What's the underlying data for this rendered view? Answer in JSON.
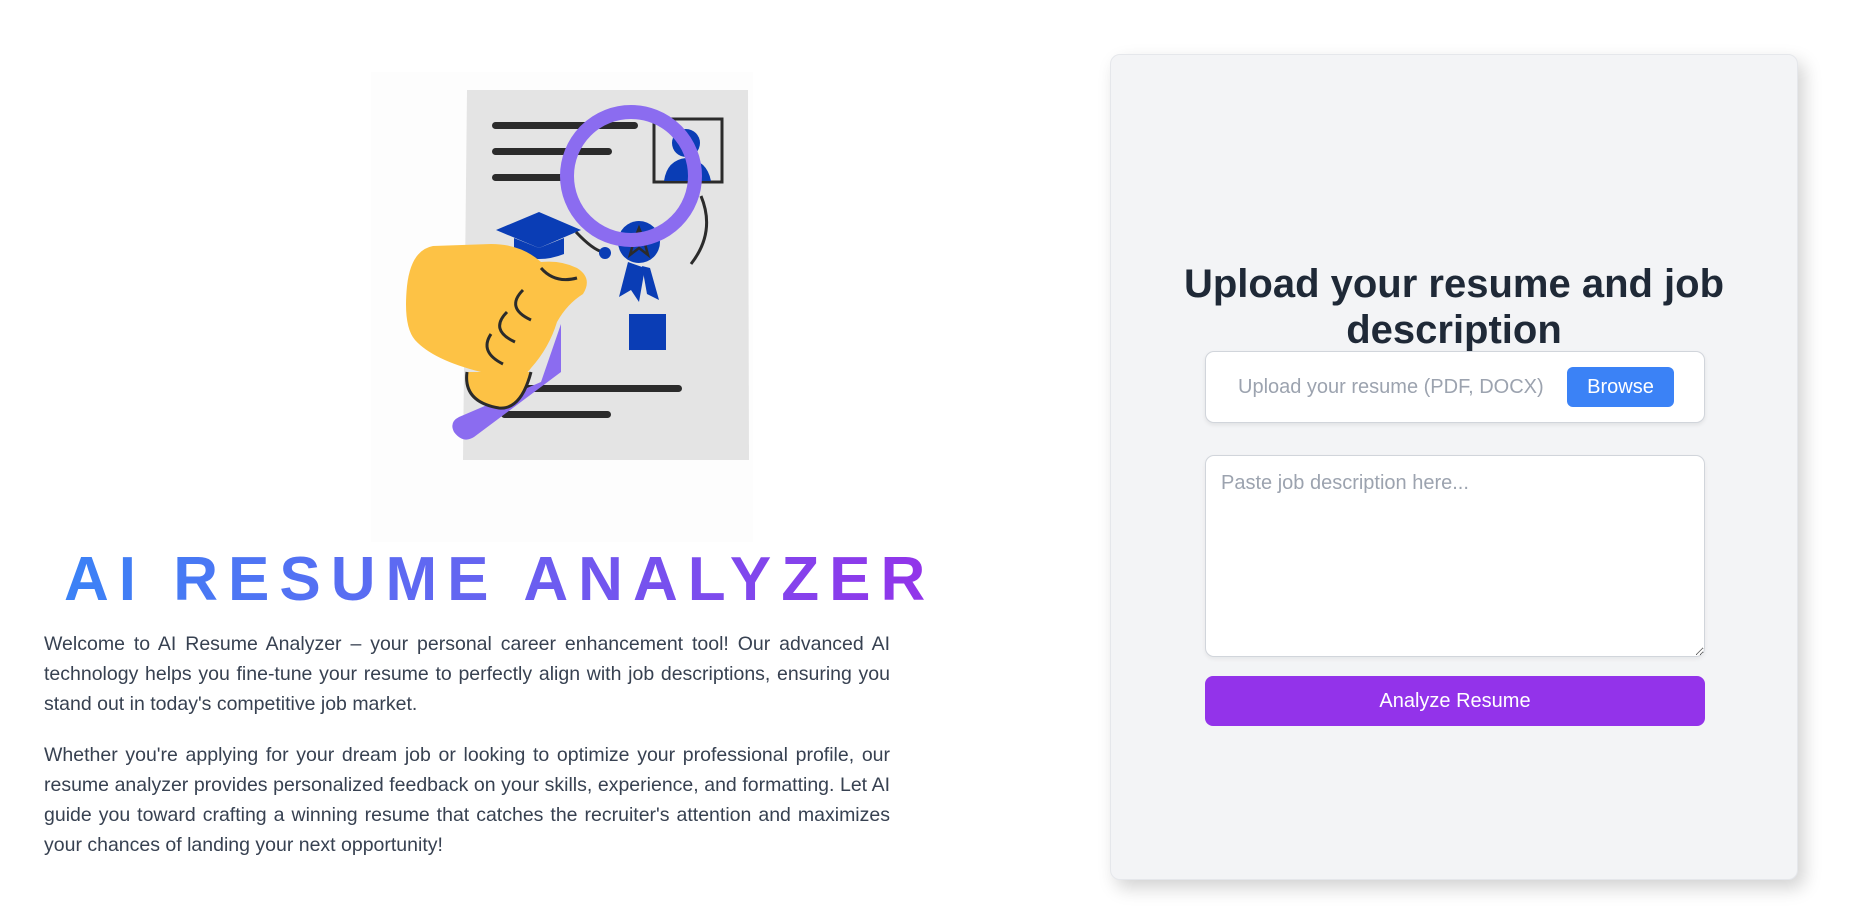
{
  "left": {
    "illustration_icon": "resume-magnifier-illustration",
    "title": "AI RESUME ANALYZER",
    "paragraphs": [
      "Welcome to AI Resume Analyzer – your personal career enhancement tool! Our advanced AI technology helps you fine-tune your resume to perfectly align with job descriptions, ensuring you stand out in today's competitive job market.",
      "Whether you're applying for your dream job or looking to optimize your professional profile, our resume analyzer provides personalized feedback on your skills, experience, and formatting. Let AI guide you toward crafting a winning resume that catches the recruiter's attention and maximizes your chances of landing your next opportunity!"
    ]
  },
  "form": {
    "title": "Upload your resume and job description",
    "upload_placeholder": "Upload your resume (PDF, DOCX)",
    "browse_label": "Browse",
    "job_description_placeholder": "Paste job description here...",
    "job_description_value": "",
    "analyze_label": "Analyze Resume"
  },
  "colors": {
    "title_gradient_start": "#3b82f6",
    "title_gradient_end": "#9333ea",
    "browse_button": "#3b82f6",
    "analyze_button": "#9333ea",
    "card_background": "#f3f4f6"
  }
}
